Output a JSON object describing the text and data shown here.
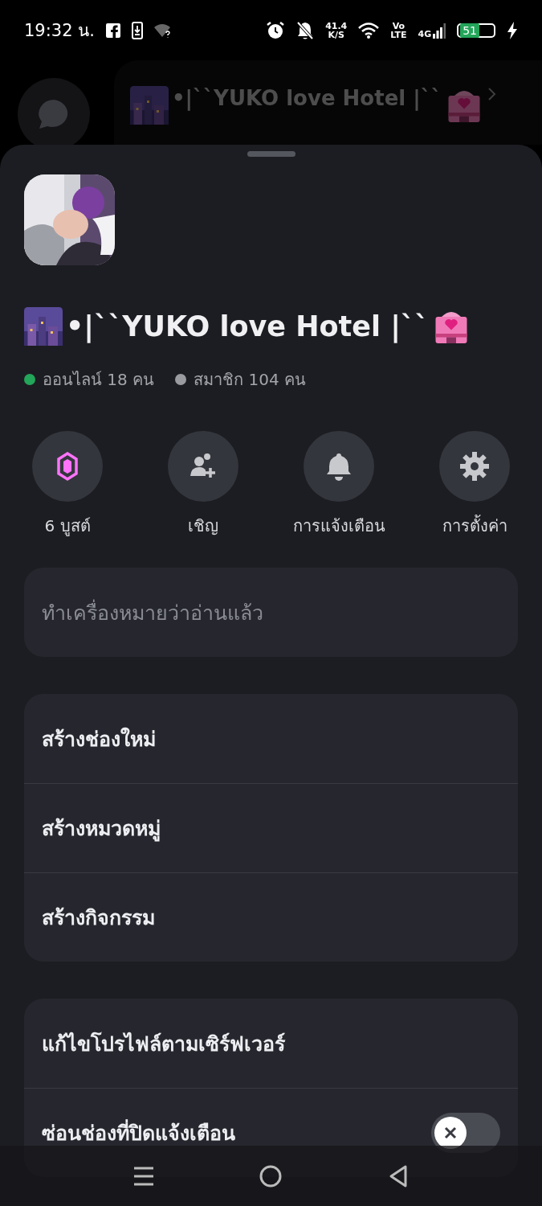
{
  "status_bar": {
    "time": "19:32 น.",
    "net_speed": "41.4",
    "net_unit": "K/S",
    "volte_top": "Vo",
    "volte_bottom": "LTE",
    "network": "4G",
    "battery": "51"
  },
  "background": {
    "title": "•|``YUKO love Hotel |``"
  },
  "sheet": {
    "server": {
      "name": "•|``YUKO love Hotel |``",
      "stats": [
        {
          "label": "ออนไลน์ 18 คน",
          "color": "#23a55a"
        },
        {
          "label": "สมาชิก 104 คน",
          "color": "#9a9ba1"
        }
      ]
    },
    "actions": [
      {
        "kind": "boost",
        "label": "6 บูสต์"
      },
      {
        "kind": "invite",
        "label": "เชิญ"
      },
      {
        "kind": "notifications",
        "label": "การแจ้งเตือน"
      },
      {
        "kind": "settings",
        "label": "การตั้งค่า"
      }
    ],
    "groups": [
      [
        {
          "label": "ทำเครื่องหมายว่าอ่านแล้ว",
          "disabled": true
        }
      ],
      [
        {
          "label": "สร้างช่องใหม่",
          "disabled": false
        },
        {
          "label": "สร้างหมวดหมู่",
          "disabled": false
        },
        {
          "label": "สร้างกิจกรรม",
          "disabled": false
        }
      ],
      [
        {
          "label": "แก้ไขโปรไฟล์ตามเซิร์ฟเวอร์",
          "disabled": false
        },
        {
          "label": "ซ่อนช่องที่ปิดแจ้งเตือน",
          "disabled": false,
          "kind": "toggle",
          "on": false
        }
      ]
    ]
  }
}
